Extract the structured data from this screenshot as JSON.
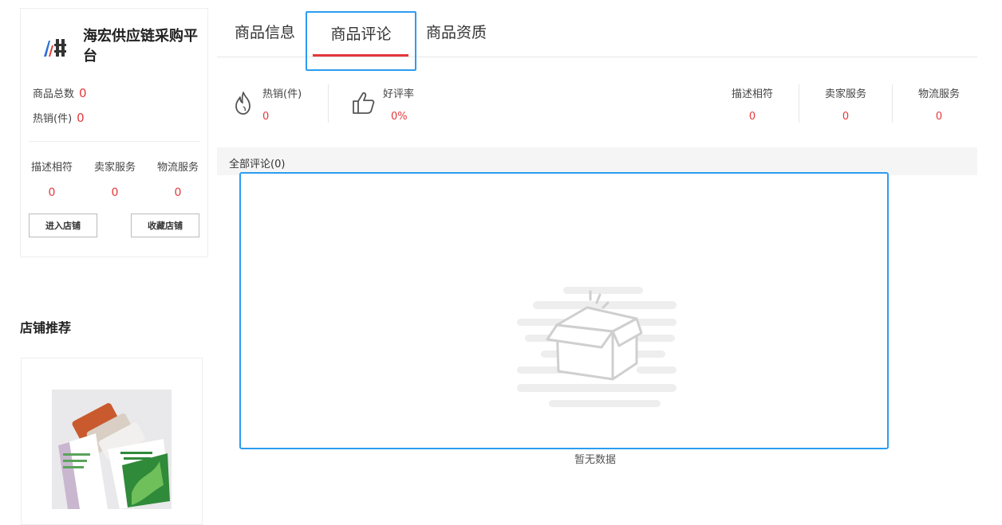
{
  "shop": {
    "name": "海宏供应链采购平台",
    "stats": [
      {
        "label": "商品总数",
        "value": "0"
      },
      {
        "label": "热销(件)",
        "value": "0"
      }
    ],
    "scores": [
      {
        "label": "描述相符",
        "value": "0"
      },
      {
        "label": "卖家服务",
        "value": "0"
      },
      {
        "label": "物流服务",
        "value": "0"
      }
    ],
    "enter_button": "进入店铺",
    "favorite_button": "收藏店铺"
  },
  "recommend": {
    "title": "店铺推荐"
  },
  "tabs": [
    {
      "label": "商品信息",
      "active": false
    },
    {
      "label": "商品评论",
      "active": true
    },
    {
      "label": "商品资质",
      "active": false
    }
  ],
  "review_stats": {
    "hot": {
      "label": "热销(件)",
      "value": "0",
      "icon": "fire-icon"
    },
    "rate": {
      "label": "好评率",
      "value": "0%",
      "icon": "thumbs-up-icon"
    },
    "scores": [
      {
        "label": "描述相符",
        "value": "0"
      },
      {
        "label": "卖家服务",
        "value": "0"
      },
      {
        "label": "物流服务",
        "value": "0"
      }
    ]
  },
  "comments": {
    "all_label": "全部评论(0)",
    "empty_text": "暂无数据",
    "empty_icon": "empty-box-icon"
  },
  "colors": {
    "accent_red": "#e4393c",
    "focus_blue": "#2d9cf0"
  }
}
